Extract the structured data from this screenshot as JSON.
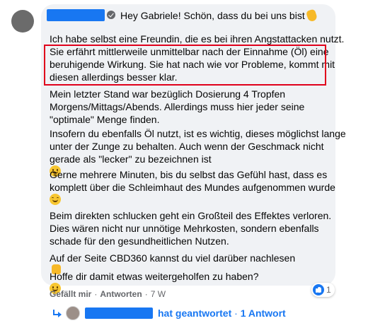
{
  "comment": {
    "greeting": "Hey Gabriele! Schön, dass du bei uns bist",
    "paragraphs": [
      [
        "Ich habe selbst eine Freundin, die es bei ihren Angstattacken nutzt.",
        "Sie erfährt mittlerweile unmittelbar nach der Einnahme (Öl) eine",
        "beruhigende Wirkung. Sie hat nach wie vor Probleme, kommt mit",
        "diesen allerdings besser klar."
      ],
      [
        "Mein letzter Stand war bezüglich Dosierung 4 Tropfen",
        "Morgens/Mittags/Abends. Allerdings muss hier jeder seine",
        "\"optimale\" Menge finden."
      ],
      [
        "Insofern du ebenfalls Öl nutzt, ist es wichtig, dieses möglichst lange",
        "unter der Zunge zu behalten. Auch wenn der Geschmack nicht",
        "gerade als \"lecker\" zu bezeichnen ist"
      ],
      [
        "Gerne mehrere Minuten, bis du selbst das Gefühl hast, dass es",
        "komplett über die Schleimhaut des Mundes aufgenommen wurde",
        ""
      ],
      [
        "Beim direkten schlucken geht ein Großteil des Effektes verloren.",
        "Dies wären nicht nur unnötige Mehrkosten, sondern ebenfalls",
        "schade für den gesundheitlichen Nutzen."
      ],
      [
        "Auf der Seite CBD360 kannst du viel darüber nachlesen"
      ],
      [
        "Hoffe dir damit etwas weitergeholfen zu haben?"
      ]
    ],
    "icons": {
      "verified": "verified-badge-icon",
      "wave": "waving-hand-emoji",
      "smile": "smiling-face-emoji",
      "blush": "blushing-face-emoji",
      "thumb": "thumbs-up-emoji"
    }
  },
  "actions": {
    "like": "Gefällt mir",
    "separator": "·",
    "reply": "Antworten",
    "time": "7 W"
  },
  "reactions": {
    "count": "1",
    "icon": "like-icon"
  },
  "replies": {
    "label": "hat geantwortet",
    "dot": "·",
    "count_label": "1 Antwort"
  },
  "colors": {
    "link": "#1877f2",
    "bubble": "#f0f2f5",
    "highlight": "#e0001b",
    "meta": "#65676b"
  }
}
